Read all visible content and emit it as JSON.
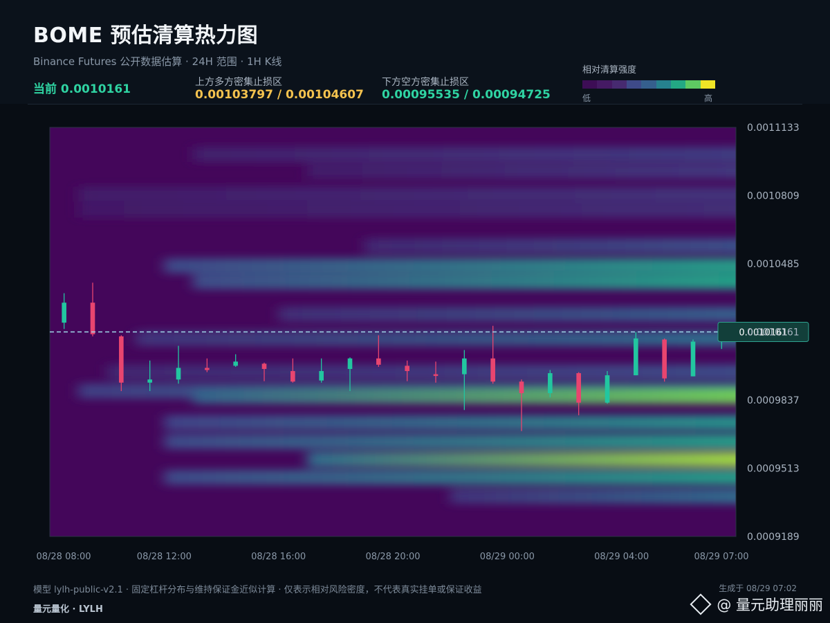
{
  "header": {
    "title": "BOME 预估清算热力图",
    "subtitle": "Binance Futures 公开数据估算 · 24H 范围 · 1H K线",
    "current": "当前 0.0010161",
    "upper_label": "上方多方密集止损区",
    "upper_value": "0.00103797 / 0.00104607",
    "lower_label": "下方空方密集止损区",
    "lower_value": "0.00095535 / 0.00094725",
    "legend_title": "相对清算强度",
    "legend_low": "低",
    "legend_high": "高",
    "legend_colors": [
      "#3d0d55",
      "#451a63",
      "#472a70",
      "#3e4a89",
      "#355f8d",
      "#26818e",
      "#23a884",
      "#5ec962",
      "#f0e426"
    ]
  },
  "footer": {
    "note": "模型 lylh-public-v2.1 · 固定杠杆分布与维持保证金近似计算 · 仅表示相对风险密度，不代表真实挂单或保证收益",
    "brand": "量元量化 · LYLH",
    "generated": "生成于 08/29 07:02",
    "watermark": "@ 量元助理丽丽"
  },
  "chart_data": {
    "type": "heatmap",
    "title": "BOME 预估清算热力图",
    "ylim": [
      0.0009189,
      0.0011133
    ],
    "y_ticks": [
      "0.0011133",
      "0.0010809",
      "0.0010485",
      "0.0010161",
      "0.0009837",
      "0.0009513",
      "0.0009189"
    ],
    "x_ticks": [
      "08/28 08:00",
      "08/28 12:00",
      "08/28 16:00",
      "08/28 20:00",
      "08/29 00:00",
      "08/29 04:00",
      "08/29 07:00"
    ],
    "current_price": 0.0010161,
    "current_label": "0.0010161",
    "candle_colors": {
      "up": "#22c6a0",
      "down": "#e8456f"
    },
    "heat_bands": [
      {
        "price": 0.0011005,
        "start_hour": 5,
        "intensity": 0.22
      },
      {
        "price": 0.0010925,
        "start_hour": 9,
        "intensity": 0.2
      },
      {
        "price": 0.0010815,
        "start_hour": 1,
        "intensity": 0.18
      },
      {
        "price": 0.001074,
        "start_hour": 1,
        "intensity": 0.16
      },
      {
        "price": 0.001057,
        "start_hour": 11,
        "intensity": 0.3
      },
      {
        "price": 0.0010475,
        "start_hour": 4,
        "intensity": 0.6
      },
      {
        "price": 0.00104,
        "start_hour": 5,
        "intensity": 0.62
      },
      {
        "price": 0.0010245,
        "start_hour": 8,
        "intensity": 0.35
      },
      {
        "price": 0.001013,
        "start_hour": 3,
        "intensity": 0.4
      },
      {
        "price": 0.000997,
        "start_hour": 2,
        "intensity": 0.28
      },
      {
        "price": 0.000988,
        "start_hour": 1,
        "intensity": 0.5
      },
      {
        "price": 0.0009855,
        "start_hour": 5,
        "intensity": 0.8
      },
      {
        "price": 0.000973,
        "start_hour": 4,
        "intensity": 0.55
      },
      {
        "price": 0.000964,
        "start_hour": 4,
        "intensity": 0.6
      },
      {
        "price": 0.0009555,
        "start_hour": 9,
        "intensity": 0.88
      },
      {
        "price": 0.000947,
        "start_hour": 4,
        "intensity": 0.6
      },
      {
        "price": 0.000938,
        "start_hour": 14,
        "intensity": 0.4
      }
    ],
    "candles": [
      {
        "t": 0.5,
        "o": 0.0010205,
        "c": 0.00103,
        "h": 0.0010345,
        "l": 0.0010175
      },
      {
        "t": 1.5,
        "o": 0.00103,
        "c": 0.001015,
        "h": 0.0010395,
        "l": 0.001014
      },
      {
        "t": 2.5,
        "o": 0.001014,
        "c": 0.000992,
        "h": 0.0010145,
        "l": 0.000988
      },
      {
        "t": 3.5,
        "o": 0.000992,
        "c": 0.0009935,
        "h": 0.0010025,
        "l": 0.000988
      },
      {
        "t": 4.5,
        "o": 0.0009935,
        "c": 0.000999,
        "h": 0.0010095,
        "l": 0.0009915
      },
      {
        "t": 5.5,
        "o": 0.000999,
        "c": 0.000998,
        "h": 0.0010035,
        "l": 0.000997
      },
      {
        "t": 6.5,
        "o": 0.001,
        "c": 0.001002,
        "h": 0.0010055,
        "l": 0.0009995
      },
      {
        "t": 7.5,
        "o": 0.001001,
        "c": 0.0009985,
        "h": 0.0010015,
        "l": 0.0009927
      },
      {
        "t": 8.5,
        "o": 0.0009975,
        "c": 0.0009925,
        "h": 0.0010035,
        "l": 0.000992
      },
      {
        "t": 9.5,
        "o": 0.000993,
        "c": 0.0009975,
        "h": 0.0010035,
        "l": 0.000992
      },
      {
        "t": 10.5,
        "o": 0.0009985,
        "c": 0.0010035,
        "h": 0.001004,
        "l": 0.000988
      },
      {
        "t": 11.5,
        "o": 0.0010035,
        "c": 0.0010005,
        "h": 0.0010145,
        "l": 0.0009995
      },
      {
        "t": 12.5,
        "o": 0.001,
        "c": 0.0009975,
        "h": 0.0010025,
        "l": 0.0009927
      },
      {
        "t": 13.5,
        "o": 0.000996,
        "c": 0.0009955,
        "h": 0.001002,
        "l": 0.000992
      },
      {
        "t": 14.5,
        "o": 0.000996,
        "c": 0.0010035,
        "h": 0.0010075,
        "l": 0.000979
      },
      {
        "t": 15.5,
        "o": 0.0010035,
        "c": 0.0009925,
        "h": 0.001019,
        "l": 0.0009915
      },
      {
        "t": 16.5,
        "o": 0.0009925,
        "c": 0.000987,
        "h": 0.0009935,
        "l": 0.000969
      },
      {
        "t": 17.5,
        "o": 0.000987,
        "c": 0.0009965,
        "h": 0.000998,
        "l": 0.000985
      },
      {
        "t": 18.5,
        "o": 0.0009965,
        "c": 0.0009825,
        "h": 0.000997,
        "l": 0.0009765
      },
      {
        "t": 19.5,
        "o": 0.0009825,
        "c": 0.0009955,
        "h": 0.0009975,
        "l": 0.000982
      },
      {
        "t": 20.5,
        "o": 0.0009955,
        "c": 0.001013,
        "h": 0.001016,
        "l": 0.0009955
      },
      {
        "t": 21.5,
        "o": 0.0010125,
        "c": 0.000994,
        "h": 0.001013,
        "l": 0.0009925
      },
      {
        "t": 22.5,
        "o": 0.000995,
        "c": 0.0010115,
        "h": 0.0010125,
        "l": 0.000995
      },
      {
        "t": 23.5,
        "o": 0.001013,
        "c": 0.001016,
        "h": 0.0010165,
        "l": 0.001008
      }
    ]
  }
}
